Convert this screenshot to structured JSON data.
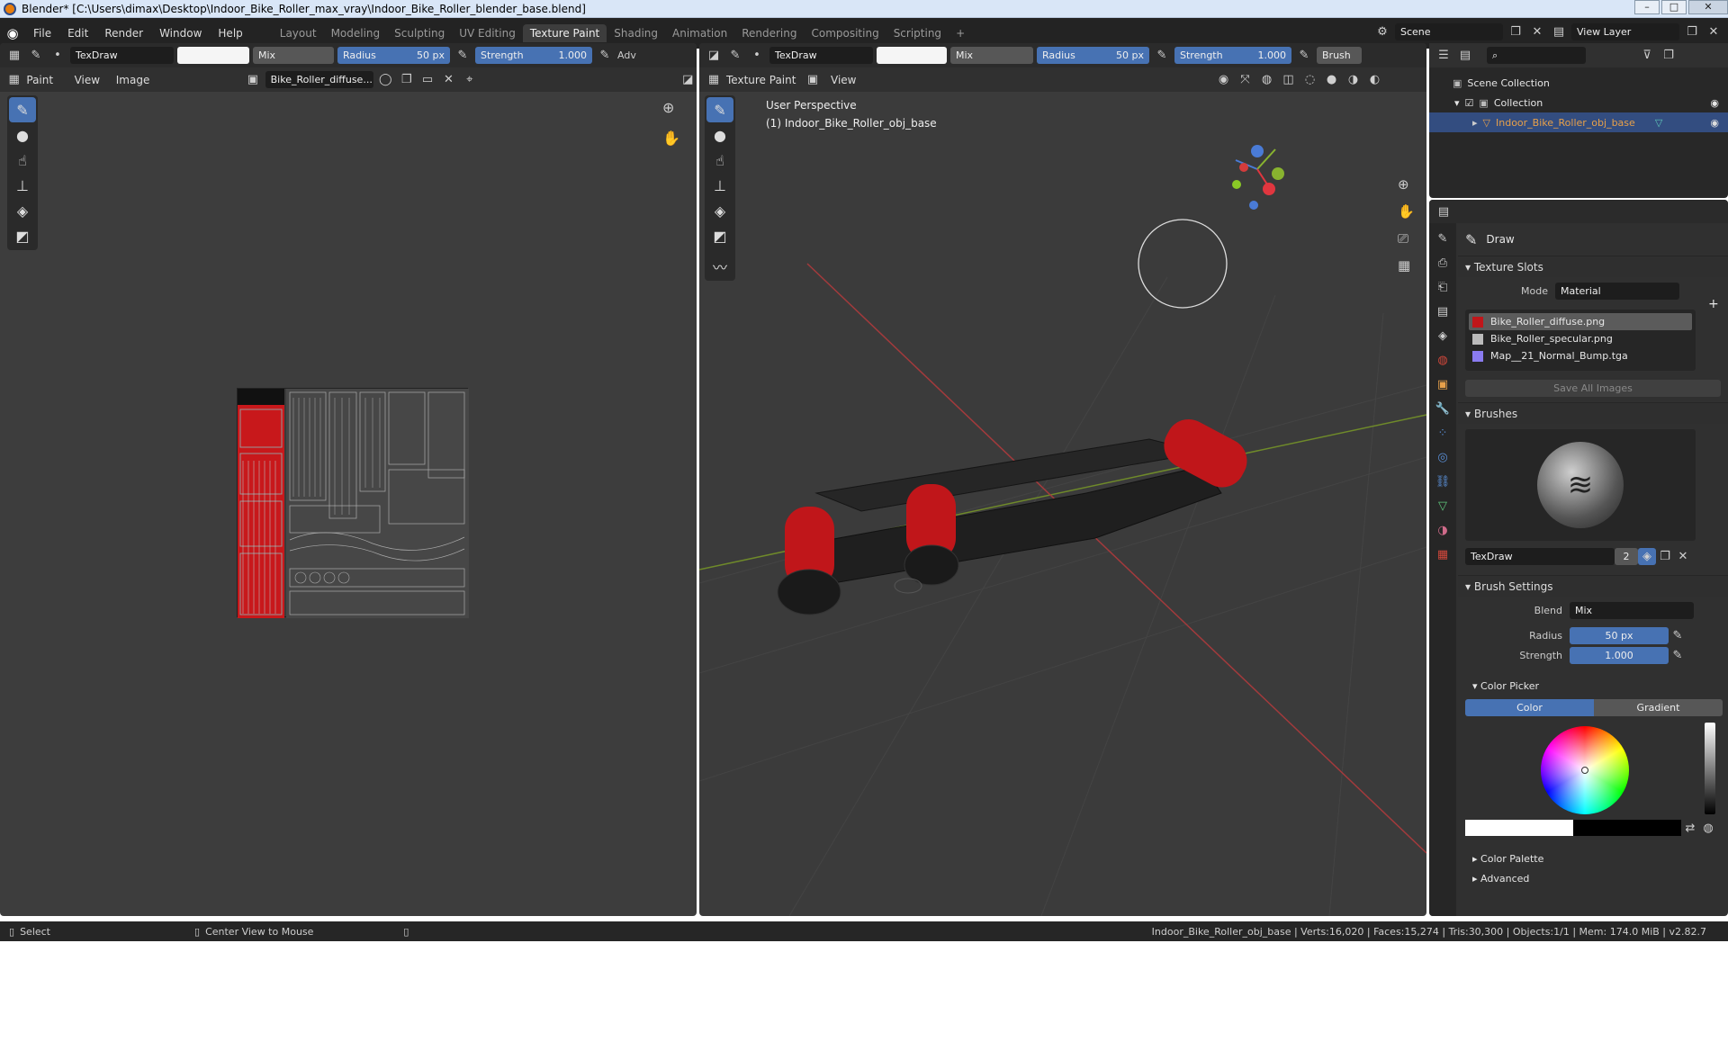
{
  "titlebar": {
    "title": "Blender* [C:\\Users\\dimax\\Desktop\\Indoor_Bike_Roller_max_vray\\Indoor_Bike_Roller_blender_base.blend]"
  },
  "menu": [
    "File",
    "Edit",
    "Render",
    "Window",
    "Help"
  ],
  "workspaces": [
    "Layout",
    "Modeling",
    "Sculpting",
    "UV Editing",
    "Texture Paint",
    "Shading",
    "Animation",
    "Rendering",
    "Compositing",
    "Scripting"
  ],
  "scene": {
    "label": "Scene",
    "view_layer": "View Layer"
  },
  "tool_header": {
    "brush": "TexDraw",
    "blend": "Mix",
    "radius_label": "Radius",
    "radius_value": "50 px",
    "strength_label": "Strength",
    "strength_value": "1.000",
    "adv": "Adv",
    "brush_menu": "Brush"
  },
  "image_editor": {
    "mode": "Paint",
    "view": "View",
    "image": "Image",
    "image_name": "Bike_Roller_diffuse..."
  },
  "viewport": {
    "mode": "Texture Paint",
    "view": "View",
    "perspective": "User Perspective",
    "object": "(1) Indoor_Bike_Roller_obj_base"
  },
  "outliner": {
    "root": "Scene Collection",
    "collection": "Collection",
    "object": "Indoor_Bike_Roller_obj_base"
  },
  "properties": {
    "tool_name": "Draw",
    "texture_slots": "Texture Slots",
    "mode_label": "Mode",
    "mode_value": "Material",
    "slots": [
      "Bike_Roller_diffuse.png",
      "Bike_Roller_specular.png",
      "Map__21_Normal_Bump.tga"
    ],
    "save_all": "Save All Images",
    "brushes": "Brushes",
    "brush_name": "TexDraw",
    "brush_users": "2",
    "brush_settings": "Brush Settings",
    "blend_label": "Blend",
    "blend_value": "Mix",
    "radius_label": "Radius",
    "radius_value": "50 px",
    "strength_label": "Strength",
    "strength_value": "1.000",
    "color_picker": "Color Picker",
    "color_tab": "Color",
    "gradient_tab": "Gradient",
    "color_palette": "Color Palette",
    "advanced": "Advanced"
  },
  "status": {
    "select": "Select",
    "center": "Center View to Mouse",
    "stats": "Indoor_Bike_Roller_obj_base | Verts:16,020 | Faces:15,274 | Tris:30,300 | Objects:1/1 | Mem: 174.0 MiB | v2.82.7"
  },
  "colors": {
    "accent": "#4772b3",
    "roller_red": "#c0161a",
    "bg": "#3d3d3d"
  }
}
